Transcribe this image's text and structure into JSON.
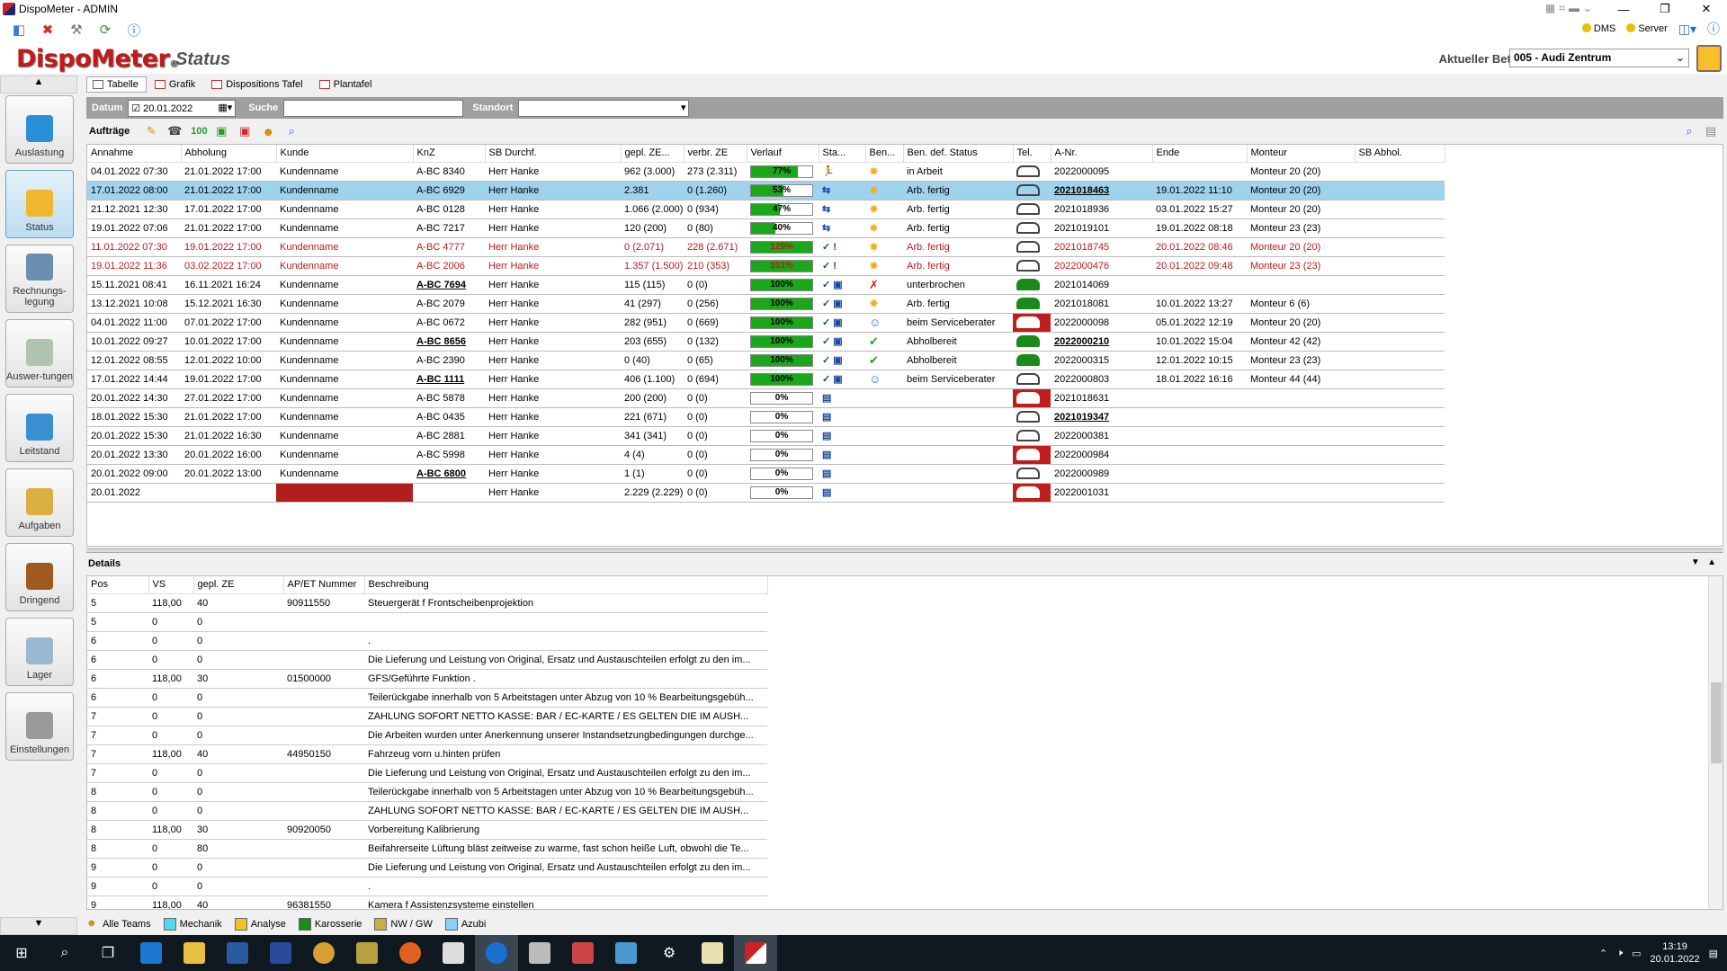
{
  "window": {
    "title": "DispoMeter - ADMIN",
    "min": "—",
    "max": "❐",
    "close": "✕"
  },
  "toolbar": {
    "status_dms": "DMS",
    "status_server": "Server"
  },
  "header": {
    "logo_main": "DispoMeter",
    "logo_suffix": "®",
    "page_title": "Status",
    "betrieb_label": "Aktueller Betrieb:",
    "betrieb_value": "005 - Audi Zentrum"
  },
  "sidebar": {
    "items": [
      {
        "label": "Auslastung",
        "color": "#2a8fd6"
      },
      {
        "label": "Status",
        "color": "#f0b830"
      },
      {
        "label": "Rechnungs-legung",
        "color": "#6a8fb0"
      },
      {
        "label": "Auswer-tungen",
        "color": "#b0c4b0"
      },
      {
        "label": "Leitstand",
        "color": "#3a8fd0"
      },
      {
        "label": "Aufgaben",
        "color": "#d9b040"
      },
      {
        "label": "Dringend",
        "color": "#a05a20"
      },
      {
        "label": "Lager",
        "color": "#9ab8d0"
      },
      {
        "label": "Einstellungen",
        "color": "#9a9a9a"
      }
    ]
  },
  "tabs": [
    "Tabelle",
    "Grafik",
    "Dispositions Tafel",
    "Plantafel"
  ],
  "filter": {
    "datum_label": "Datum",
    "datum_value": "20.01.2022",
    "suche_label": "Suche",
    "suche_value": "",
    "standort_label": "Standort",
    "standort_value": ""
  },
  "auftraege": {
    "label": "Aufträge"
  },
  "grid": {
    "columns": [
      "Annahme",
      "Abholung",
      "Kunde",
      "KnZ",
      "SB Durchf.",
      "gepl. ZE...",
      "verbr. ZE",
      "Verlauf",
      "Sta...",
      "Ben...",
      "Ben. def. Status",
      "Tel.",
      "A-Nr.",
      "Ende",
      "Monteur",
      "SB Abhol."
    ],
    "rows": [
      {
        "annahme": "04.01.2022 07:30",
        "abholung": "21.01.2022 17:00",
        "kunde": "Kundenname",
        "knz": "A-BC 8340",
        "sb": "Herr Hanke",
        "gepl": "962 (3.000)",
        "verbr": "273 (2.311)",
        "pct": 77,
        "pct_label": "77%",
        "status": "🏃",
        "ben": "✸",
        "bendef": "in Arbeit",
        "tel": "normal",
        "anr": "2022000095",
        "ende": "",
        "monteur": "Monteur 20 (20)",
        "sel": false,
        "red": false,
        "knz_bold": false,
        "anr_bold": false
      },
      {
        "annahme": "17.01.2022 08:00",
        "abholung": "21.01.2022 17:00",
        "kunde": "Kundenname",
        "knz": "A-BC 6929",
        "sb": "Herr Hanke",
        "gepl": "2.381",
        "verbr": "0 (1.260)",
        "pct": 53,
        "pct_label": "53%",
        "status": "⇆",
        "ben": "✸",
        "bendef": "Arb. fertig",
        "tel": "normal",
        "anr": "2021018463",
        "ende": "19.01.2022 11:10",
        "monteur": "Monteur 20 (20)",
        "sel": true,
        "red": false,
        "knz_bold": false,
        "anr_bold": true
      },
      {
        "annahme": "21.12.2021 12:30",
        "abholung": "17.01.2022 17:00",
        "kunde": "Kundenname",
        "knz": "A-BC 0128",
        "sb": "Herr Hanke",
        "gepl": "1.066 (2.000)",
        "verbr": "0 (934)",
        "pct": 47,
        "pct_label": "47%",
        "status": "⇆",
        "ben": "✸",
        "bendef": "Arb. fertig",
        "tel": "normal",
        "anr": "2021018936",
        "ende": "03.01.2022 15:27",
        "monteur": "Monteur 20 (20)",
        "sel": false,
        "red": false,
        "knz_bold": false,
        "anr_bold": false
      },
      {
        "annahme": "19.01.2022 07:06",
        "abholung": "21.01.2022 17:00",
        "kunde": "Kundenname",
        "knz": "A-BC 7217",
        "sb": "Herr Hanke",
        "gepl": "120 (200)",
        "verbr": "0 (80)",
        "pct": 40,
        "pct_label": "40%",
        "status": "⇆",
        "ben": "✸",
        "bendef": "Arb. fertig",
        "tel": "normal",
        "anr": "2021019101",
        "ende": "19.01.2022 08:18",
        "monteur": "Monteur 23 (23)",
        "sel": false,
        "red": false,
        "knz_bold": false,
        "anr_bold": false
      },
      {
        "annahme": "11.01.2022 07:30",
        "abholung": "19.01.2022 17:00",
        "kunde": "Kundenname",
        "knz": "A-BC 4777",
        "sb": "Herr Hanke",
        "gepl": "0 (2.071)",
        "verbr": "228 (2.671)",
        "pct": 100,
        "pct_label": "129%",
        "status": "✓ !",
        "ben": "✸",
        "bendef": "Arb. fertig",
        "tel": "normal",
        "anr": "2021018745",
        "ende": "20.01.2022 08:46",
        "monteur": "Monteur 20 (20)",
        "sel": false,
        "red": true,
        "knz_bold": false,
        "anr_bold": false
      },
      {
        "annahme": "19.01.2022 11:36",
        "abholung": "03.02.2022 17:00",
        "kunde": "Kundenname",
        "knz": "A-BC 2006",
        "sb": "Herr Hanke",
        "gepl": "1.357 (1.500)",
        "verbr": "210 (353)",
        "pct": 100,
        "pct_label": "101%",
        "status": "✓ !",
        "ben": "✸",
        "bendef": "Arb. fertig",
        "tel": "normal",
        "anr": "2022000476",
        "ende": "20.01.2022 09:48",
        "monteur": "Monteur 23 (23)",
        "sel": false,
        "red": true,
        "knz_bold": false,
        "anr_bold": false
      },
      {
        "annahme": "15.11.2021 08:41",
        "abholung": "16.11.2021 16:24",
        "kunde": "Kundenname",
        "knz": "A-BC 7694",
        "sb": "Herr Hanke",
        "gepl": "115 (115)",
        "verbr": "0 (0)",
        "pct": 100,
        "pct_label": "100%",
        "status": "✓ ▣",
        "ben": "✗",
        "bendef": "unterbrochen",
        "tel": "green",
        "anr": "2021014069",
        "ende": "",
        "monteur": "",
        "sel": false,
        "red": false,
        "knz_bold": true,
        "anr_bold": false
      },
      {
        "annahme": "13.12.2021 10:08",
        "abholung": "15.12.2021 16:30",
        "kunde": "Kundenname",
        "knz": "A-BC 2079",
        "sb": "Herr Hanke",
        "gepl": "41 (297)",
        "verbr": "0 (256)",
        "pct": 100,
        "pct_label": "100%",
        "status": "✓ ▣",
        "ben": "✸",
        "bendef": "Arb. fertig",
        "tel": "green",
        "anr": "2021018081",
        "ende": "10.01.2022 13:27",
        "monteur": "Monteur 6 (6)",
        "sel": false,
        "red": false,
        "knz_bold": false,
        "anr_bold": false
      },
      {
        "annahme": "04.01.2022 11:00",
        "abholung": "07.01.2022 17:00",
        "kunde": "Kundenname",
        "knz": "A-BC 0672",
        "sb": "Herr Hanke",
        "gepl": "282 (951)",
        "verbr": "0 (669)",
        "pct": 100,
        "pct_label": "100%",
        "status": "✓ ▣",
        "ben": "☺",
        "bendef": "beim Serviceberater",
        "tel": "red",
        "anr": "2022000098",
        "ende": "05.01.2022 12:19",
        "monteur": "Monteur 20 (20)",
        "sel": false,
        "red": false,
        "knz_bold": false,
        "anr_bold": false
      },
      {
        "annahme": "10.01.2022 09:27",
        "abholung": "10.01.2022 17:00",
        "kunde": "Kundenname",
        "knz": "A-BC 8656",
        "sb": "Herr Hanke",
        "gepl": "203 (655)",
        "verbr": "0 (132)",
        "pct": 100,
        "pct_label": "100%",
        "status": "✓ ▣",
        "ben": "✔",
        "bendef": "Abholbereit",
        "tel": "green",
        "anr": "2022000210",
        "ende": "10.01.2022 15:04",
        "monteur": "Monteur 42 (42)",
        "sel": false,
        "red": false,
        "knz_bold": true,
        "anr_bold": true
      },
      {
        "annahme": "12.01.2022 08:55",
        "abholung": "12.01.2022 10:00",
        "kunde": "Kundenname",
        "knz": "A-BC 2390",
        "sb": "Herr Hanke",
        "gepl": "0 (40)",
        "verbr": "0 (65)",
        "pct": 100,
        "pct_label": "100%",
        "status": "✓ ▣",
        "ben": "✔",
        "bendef": "Abholbereit",
        "tel": "green",
        "anr": "2022000315",
        "ende": "12.01.2022 10:15",
        "monteur": "Monteur 23 (23)",
        "sel": false,
        "red": false,
        "knz_bold": false,
        "anr_bold": false
      },
      {
        "annahme": "17.01.2022 14:44",
        "abholung": "19.01.2022 17:00",
        "kunde": "Kundenname",
        "knz": "A-BC 1111",
        "sb": "Herr Hanke",
        "gepl": "406 (1.100)",
        "verbr": "0 (694)",
        "pct": 100,
        "pct_label": "100%",
        "status": "✓ ▣",
        "ben": "☺",
        "bendef": "beim Serviceberater",
        "tel": "normal",
        "anr": "2022000803",
        "ende": "18.01.2022 16:16",
        "monteur": "Monteur 44 (44)",
        "sel": false,
        "red": false,
        "knz_bold": true,
        "anr_bold": false
      },
      {
        "annahme": "20.01.2022 14:30",
        "abholung": "27.01.2022 17:00",
        "kunde": "Kundenname",
        "knz": "A-BC 5878",
        "sb": "Herr Hanke",
        "gepl": "200 (200)",
        "verbr": "0 (0)",
        "pct": 0,
        "pct_label": "0%",
        "status": "▤",
        "ben": "",
        "bendef": "",
        "tel": "red",
        "anr": "2021018631",
        "ende": "",
        "monteur": "",
        "sel": false,
        "red": false,
        "knz_bold": false,
        "anr_bold": false
      },
      {
        "annahme": "18.01.2022 15:30",
        "abholung": "21.01.2022 17:00",
        "kunde": "Kundenname",
        "knz": "A-BC 0435",
        "sb": "Herr Hanke",
        "gepl": "221 (671)",
        "verbr": "0 (0)",
        "pct": 0,
        "pct_label": "0%",
        "status": "▤",
        "ben": "",
        "bendef": "",
        "tel": "normal",
        "anr": "2021019347",
        "ende": "",
        "monteur": "",
        "sel": false,
        "red": false,
        "knz_bold": false,
        "anr_bold": true
      },
      {
        "annahme": "20.01.2022 15:30",
        "abholung": "21.01.2022 16:30",
        "kunde": "Kundenname",
        "knz": "A-BC 2881",
        "sb": "Herr Hanke",
        "gepl": "341 (341)",
        "verbr": "0 (0)",
        "pct": 0,
        "pct_label": "0%",
        "status": "▤",
        "ben": "",
        "bendef": "",
        "tel": "normal",
        "anr": "2022000381",
        "ende": "",
        "monteur": "",
        "sel": false,
        "red": false,
        "knz_bold": false,
        "anr_bold": false
      },
      {
        "annahme": "20.01.2022 13:30",
        "abholung": "20.01.2022 16:00",
        "kunde": "Kundenname",
        "knz": "A-BC 5998",
        "sb": "Herr Hanke",
        "gepl": "4 (4)",
        "verbr": "0 (0)",
        "pct": 0,
        "pct_label": "0%",
        "status": "▤",
        "ben": "",
        "bendef": "",
        "tel": "red",
        "anr": "2022000984",
        "ende": "",
        "monteur": "",
        "sel": false,
        "red": false,
        "knz_bold": false,
        "anr_bold": false
      },
      {
        "annahme": "20.01.2022 09:00",
        "abholung": "20.01.2022 13:00",
        "kunde": "Kundenname",
        "knz": "A-BC 6800",
        "sb": "Herr Hanke",
        "gepl": "1 (1)",
        "verbr": "0 (0)",
        "pct": 0,
        "pct_label": "0%",
        "status": "▤",
        "ben": "",
        "bendef": "",
        "tel": "normal",
        "anr": "2022000989",
        "ende": "",
        "monteur": "",
        "sel": false,
        "red": false,
        "knz_bold": true,
        "anr_bold": false
      },
      {
        "annahme": "20.01.2022",
        "abholung": "",
        "kunde": "",
        "knz": "",
        "sb": "Herr Hanke",
        "gepl": "2.229 (2.229)",
        "verbr": "0 (0)",
        "pct": 0,
        "pct_label": "0%",
        "status": "▤",
        "ben": "",
        "bendef": "",
        "tel": "red",
        "anr": "2022001031",
        "ende": "",
        "monteur": "",
        "sel": false,
        "red": false,
        "knz_bold": false,
        "anr_bold": false,
        "kunde_red": true
      }
    ]
  },
  "details": {
    "label": "Details",
    "columns": [
      "Pos",
      "VS",
      "gepl. ZE",
      "AP/ET Nummer",
      "Beschreibung"
    ],
    "rows": [
      [
        "5",
        "118,00",
        "40",
        "90911550",
        "Steuergerät f Frontscheibenprojektion"
      ],
      [
        "5",
        "0",
        "0",
        "",
        ""
      ],
      [
        "6",
        "0",
        "0",
        "",
        "."
      ],
      [
        "6",
        "0",
        "0",
        "",
        "Die Lieferung und Leistung von Original, Ersatz und Austauschteilen erfolgt zu den im..."
      ],
      [
        "6",
        "118,00",
        "30",
        "01500000",
        "GFS/Geführte Funktion ."
      ],
      [
        "6",
        "0",
        "0",
        "",
        "Teilerückgabe innerhalb von 5 Arbeitstagen unter Abzug von 10 % Bearbeitungsgebüh..."
      ],
      [
        "7",
        "0",
        "0",
        "",
        "ZAHLUNG SOFORT NETTO KASSE: BAR / EC-KARTE /  ES GELTEN DIE IM AUSH..."
      ],
      [
        "7",
        "0",
        "0",
        "",
        "Die Arbeiten wurden unter Anerkennung unserer Instandsetzungbedingungen durchge..."
      ],
      [
        "7",
        "118,00",
        "40",
        "44950150",
        "Fahrzeug vorn u.hinten prüfen"
      ],
      [
        "7",
        "0",
        "0",
        "",
        "Die Lieferung und Leistung von Original, Ersatz und Austauschteilen erfolgt zu den im..."
      ],
      [
        "8",
        "0",
        "0",
        "",
        "Teilerückgabe innerhalb von 5 Arbeitstagen unter Abzug von 10 % Bearbeitungsgebüh..."
      ],
      [
        "8",
        "0",
        "0",
        "",
        "ZAHLUNG SOFORT NETTO KASSE: BAR / EC-KARTE /  ES GELTEN DIE IM AUSH..."
      ],
      [
        "8",
        "118,00",
        "30",
        "90920050",
        "Vorbereitung Kalibrierung"
      ],
      [
        "8",
        "0",
        "80",
        "",
        "Beifahrerseite Lüftung bläst zeitweise zu warme, fast schon heiße Luft, obwohl die Te..."
      ],
      [
        "9",
        "0",
        "0",
        "",
        "Die Lieferung und Leistung von Original, Ersatz und Austauschteilen erfolgt zu den im..."
      ],
      [
        "9",
        "0",
        "0",
        "",
        "."
      ],
      [
        "9",
        "118,00",
        "40",
        "96381550",
        "Kamera f Assistenzsysteme einstellen"
      ]
    ]
  },
  "teams": [
    {
      "label": "Alle Teams",
      "color": ""
    },
    {
      "label": "Mechanik",
      "color": "#4fd8f0"
    },
    {
      "label": "Analyse",
      "color": "#f0c030"
    },
    {
      "label": "Karosserie",
      "color": "#1a8a1a"
    },
    {
      "label": "NW / GW",
      "color": "#c8b040"
    },
    {
      "label": "Azubi",
      "color": "#8ad0f0"
    }
  ],
  "taskbar": {
    "time": "13:19",
    "date": "20.01.2022"
  }
}
